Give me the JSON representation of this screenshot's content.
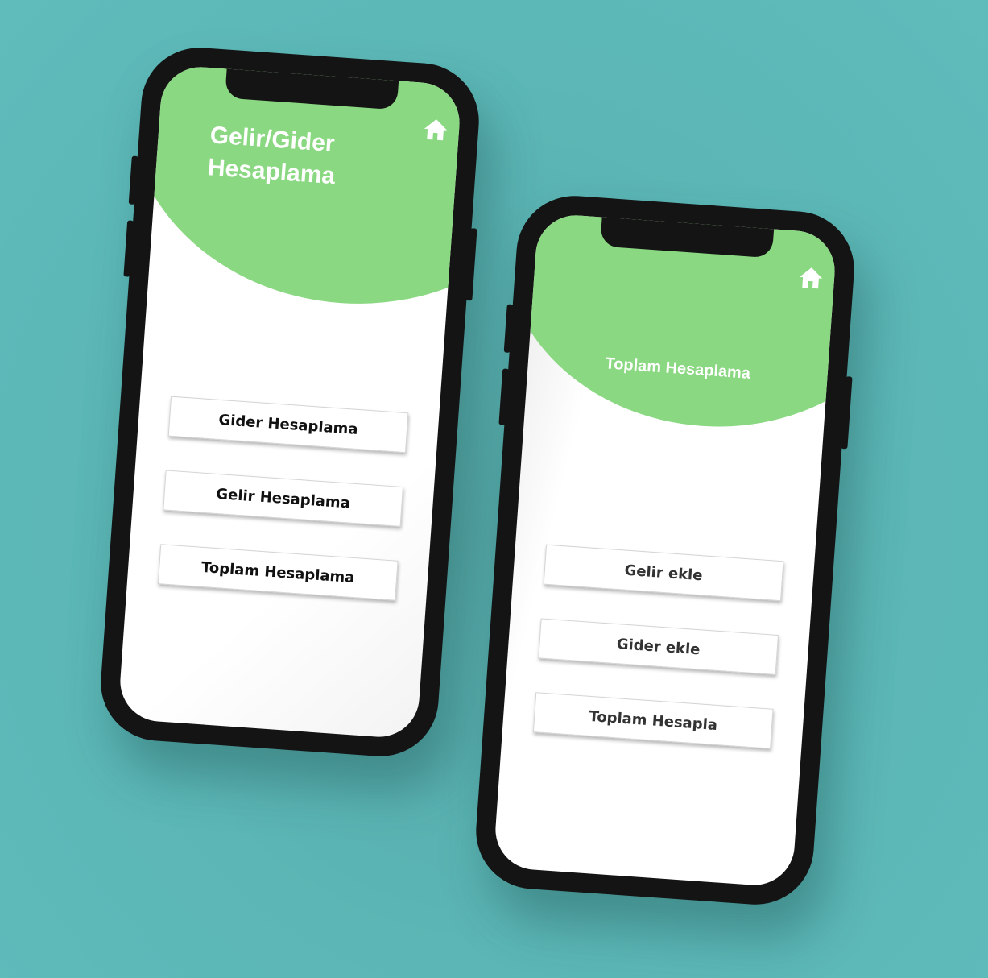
{
  "screens": [
    {
      "title": "Gelir/Gider Hesaplama",
      "home_icon": "home-icon",
      "buttons": [
        "Gider Hesaplama",
        "Gelir Hesaplama",
        "Toplam Hesaplama"
      ]
    },
    {
      "title": "Toplam Hesaplama",
      "home_icon": "home-icon",
      "buttons": [
        "Gelir ekle",
        "Gider ekle",
        "Toplam Hesapla"
      ]
    }
  ],
  "colors": {
    "background": "#5bb6b5",
    "header_green": "#8bd882",
    "phone_frame": "#141414"
  }
}
